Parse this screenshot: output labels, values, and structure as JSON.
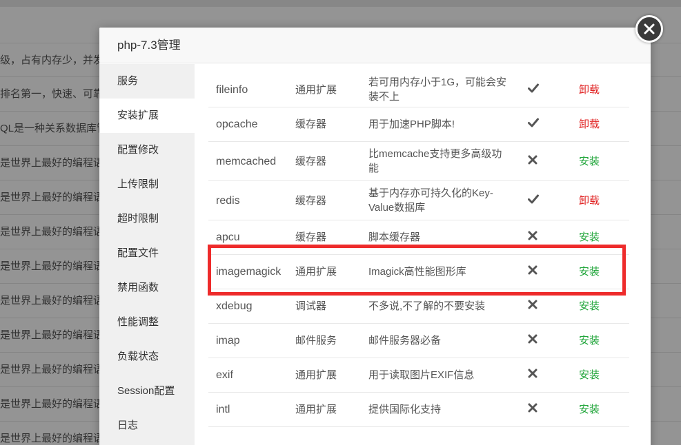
{
  "background": {
    "rows": [
      "级，占有内存少，并发",
      "排名第一，快速、可靠",
      "QL是一种关系数据库管",
      "是世界上最好的编程语",
      "是世界上最好的编程语",
      "是世界上最好的编程语",
      "是世界上最好的编程语",
      "是世界上最好的编程语",
      "是世界上最好的编程语",
      "是世界上最好的编程语",
      "是世界上最好的编程语",
      "是世界上最好的编程语"
    ]
  },
  "dialog": {
    "title": "php-7.3管理",
    "close_icon": "close-icon"
  },
  "sidebar": {
    "items": [
      {
        "label": "服务"
      },
      {
        "label": "安装扩展"
      },
      {
        "label": "配置修改"
      },
      {
        "label": "上传限制"
      },
      {
        "label": "超时限制"
      },
      {
        "label": "配置文件"
      },
      {
        "label": "禁用函数"
      },
      {
        "label": "性能调整"
      },
      {
        "label": "负载状态"
      },
      {
        "label": "Session配置"
      },
      {
        "label": "日志"
      }
    ],
    "active_index": 1
  },
  "extensions": {
    "rows": [
      {
        "name": "fileinfo",
        "type": "通用扩展",
        "desc": "若可用内存小于1G，可能会安装不上",
        "status": "installed",
        "action": "卸载"
      },
      {
        "name": "opcache",
        "type": "缓存器",
        "desc": "用于加速PHP脚本!",
        "status": "installed",
        "action": "卸载"
      },
      {
        "name": "memcached",
        "type": "缓存器",
        "desc": "比memcache支持更多高级功能",
        "status": "not-installed",
        "action": "安装"
      },
      {
        "name": "redis",
        "type": "缓存器",
        "desc": "基于内存亦可持久化的Key-Value数据库",
        "status": "installed",
        "action": "卸载"
      },
      {
        "name": "apcu",
        "type": "缓存器",
        "desc": "脚本缓存器",
        "status": "not-installed",
        "action": "安装"
      },
      {
        "name": "imagemagick",
        "type": "通用扩展",
        "desc": "Imagick高性能图形库",
        "status": "not-installed",
        "action": "安装"
      },
      {
        "name": "xdebug",
        "type": "调试器",
        "desc": "不多说,不了解的不要安装",
        "status": "not-installed",
        "action": "安装"
      },
      {
        "name": "imap",
        "type": "邮件服务",
        "desc": "邮件服务器必备",
        "status": "not-installed",
        "action": "安装"
      },
      {
        "name": "exif",
        "type": "通用扩展",
        "desc": "用于读取图片EXIF信息",
        "status": "not-installed",
        "action": "安装"
      },
      {
        "name": "intl",
        "type": "通用扩展",
        "desc": "提供国际化支持",
        "status": "not-installed",
        "action": "安装"
      }
    ],
    "status_icons": {
      "installed": "check-icon",
      "not-installed": "cross-icon"
    }
  },
  "colors": {
    "uninstall": "#e02020",
    "install": "#20a53a",
    "highlight": "#ee2b2b"
  }
}
